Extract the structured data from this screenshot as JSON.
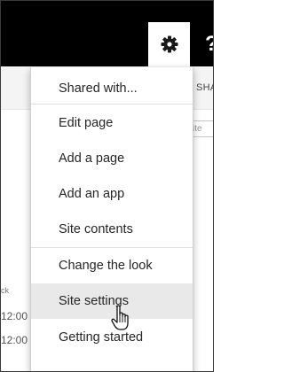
{
  "header": {
    "settings_icon": "gear-icon",
    "help_glyph": "?"
  },
  "toolbar": {
    "share_label": "SHA",
    "search_placeholder": "site"
  },
  "background": {
    "partial_text": "ck",
    "time_1": "12:00 .",
    "time_2": "12:00 ."
  },
  "settings_menu": {
    "items": [
      {
        "label": "Shared with..."
      },
      {
        "label": "Edit page"
      },
      {
        "label": "Add a page"
      },
      {
        "label": "Add an app"
      },
      {
        "label": "Site contents"
      },
      {
        "label": "Change the look"
      },
      {
        "label": "Site settings",
        "hovered": true
      },
      {
        "label": "Getting started"
      }
    ]
  },
  "cursor": {
    "icon": "hand-pointer-icon"
  },
  "colors": {
    "top_bar": "#000000",
    "hover_background": "#e9e9e9"
  }
}
